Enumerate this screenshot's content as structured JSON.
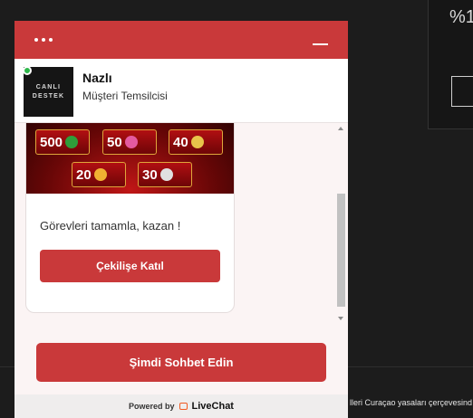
{
  "background": {
    "percent_text": "%1",
    "footer_text": "lleri Curaçao yasaları çerçevesind"
  },
  "widget": {
    "header": {
      "accent_color": "#c9393a"
    },
    "agent": {
      "avatar_text": [
        "CANLI",
        "DESTEK"
      ],
      "name": "Nazlı",
      "role": "Müşteri Temsilcisi",
      "status": "online"
    },
    "message_card": {
      "banner_numbers": [
        "500",
        "50",
        "40",
        "20",
        "30"
      ],
      "text": "Görevleri tamamla, kazan !",
      "button_label": "Çekilişe Katıl"
    },
    "cta_label": "Şimdi Sohbet Edin",
    "footer": {
      "powered_by": "Powered by",
      "brand": "LiveChat"
    }
  }
}
